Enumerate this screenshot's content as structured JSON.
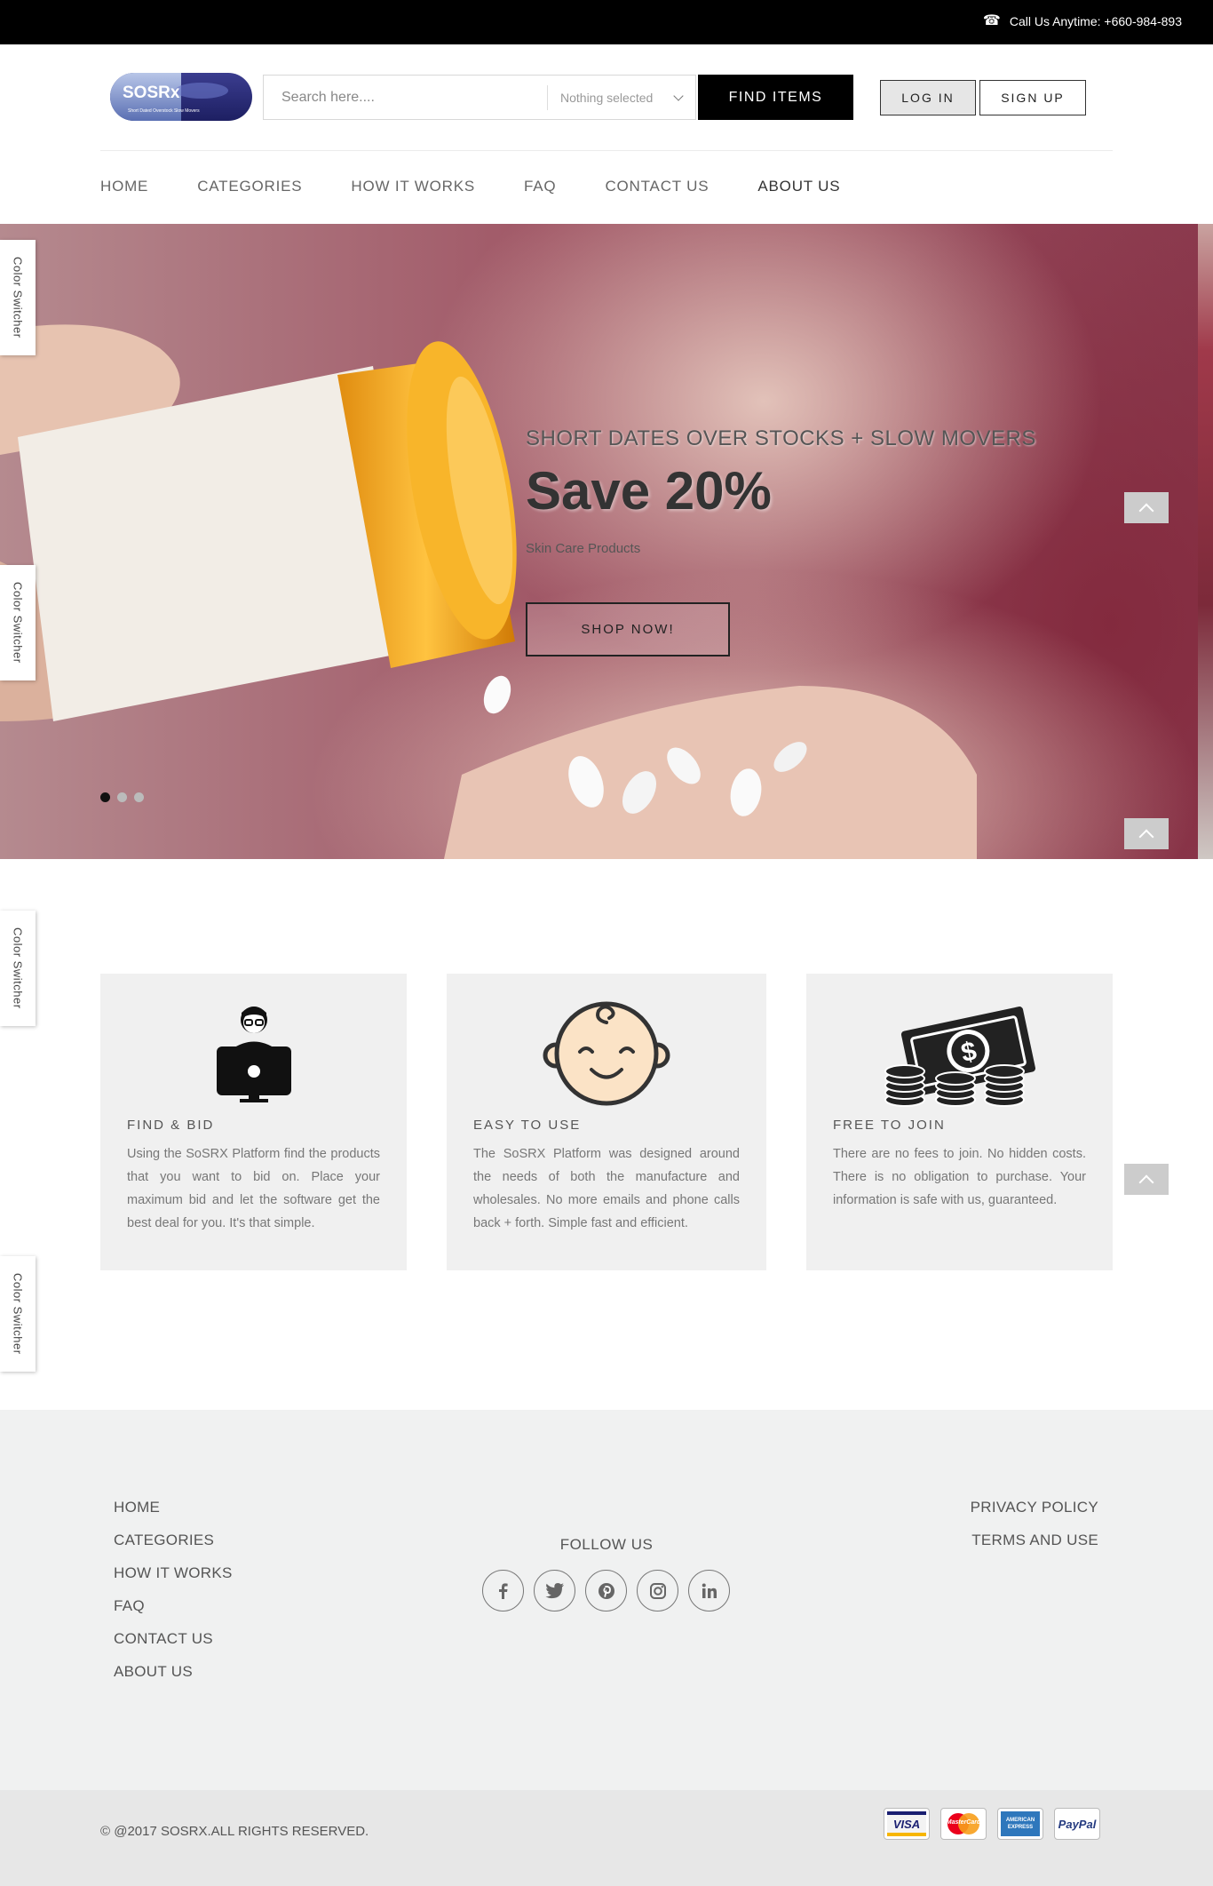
{
  "topbar": {
    "call_label": "Call Us Anytime: +660-984-893"
  },
  "header": {
    "logo_text": "SOSRx",
    "logo_tagline": "Short Dated Overstock Slow Movers",
    "search_placeholder": "Search here....",
    "select_value": "Nothing selected",
    "find_label": "FIND ITEMS",
    "login_label": "LOG IN",
    "signup_label": "SIGN UP"
  },
  "nav": {
    "items": [
      "HOME",
      "CATEGORIES",
      "HOW IT WORKS",
      "FAQ",
      "CONTACT US",
      "ABOUT US"
    ]
  },
  "hero": {
    "subtitle": "SHORT DATES OVER STOCKS + SLOW MOVERS",
    "title": "Save 20%",
    "small": "Skin Care Products",
    "button": "SHOP NOW!",
    "slide_count": 3,
    "active_slide": 1
  },
  "switcher_label": "Color Switcher",
  "features": [
    {
      "icon": "developer-icon",
      "title": "FIND & BID",
      "text": "Using the SoSRX Platform find the products that you want to bid on. Place your maximum bid and let the software get the best deal for you. It's that simple."
    },
    {
      "icon": "baby-face-icon",
      "title": "EASY TO USE",
      "text": "The SoSRX Platform was designed around the needs of both the manufacture and wholesales. No more emails and phone calls back + forth. Simple fast and efficient."
    },
    {
      "icon": "money-icon",
      "title": "FREE TO JOIN",
      "text": "There are no fees to join. No hidden costs. There is no obligation to purchase. Your information is safe with us, guaranteed."
    }
  ],
  "footer": {
    "links": [
      "HOME",
      "CATEGORIES",
      "HOW IT WORKS",
      "FAQ",
      "CONTACT US",
      "ABOUT US"
    ],
    "right_links": [
      "PRIVACY POLICY",
      "TERMS AND USE"
    ],
    "follow_label": "FOLLOW US",
    "socials": [
      "facebook-icon",
      "twitter-icon",
      "pinterest-icon",
      "instagram-icon",
      "linkedin-icon"
    ],
    "copyright": "© @2017 SOSRX.ALL RIGHTS RESERVED.",
    "payments": [
      "VISA",
      "MasterCard",
      "AMERICAN EXPRESS",
      "PayPal"
    ]
  }
}
